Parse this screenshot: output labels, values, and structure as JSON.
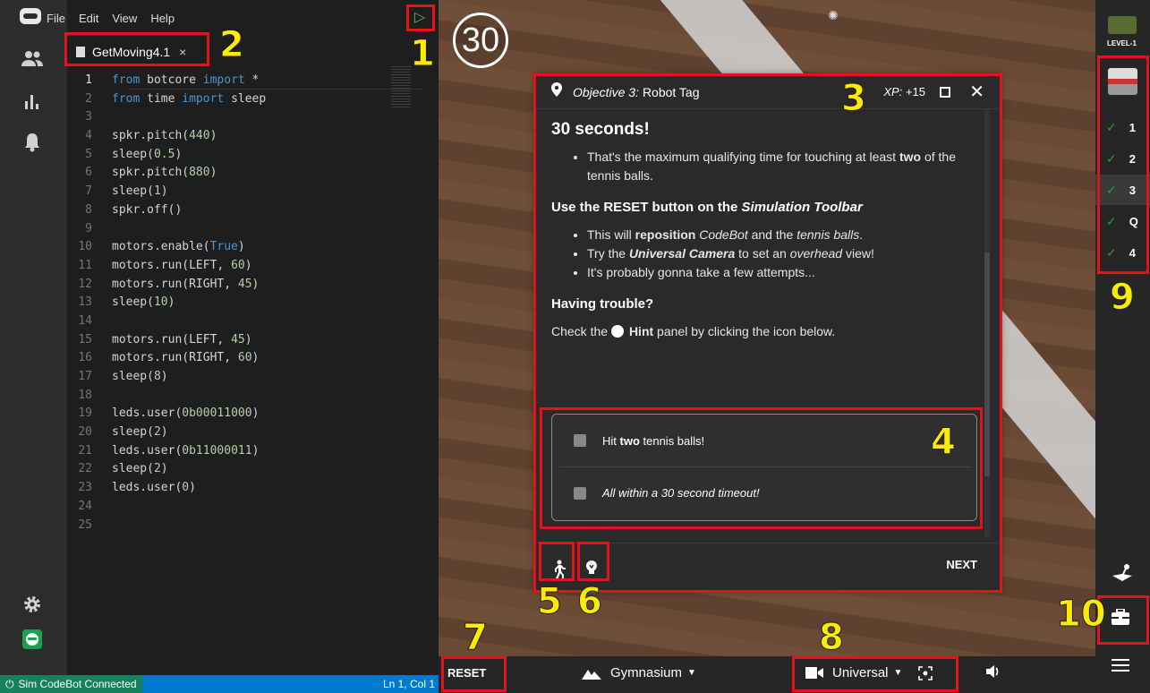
{
  "menu": {
    "file": "File",
    "edit": "Edit",
    "view": "View",
    "help": "Help"
  },
  "tab": {
    "filename": "GetMoving4.1",
    "close": "×"
  },
  "code": [
    {
      "n": "1",
      "t": "from botcore import *"
    },
    {
      "n": "2",
      "t": "from time import sleep"
    },
    {
      "n": "3",
      "t": ""
    },
    {
      "n": "4",
      "t": "spkr.pitch(440)"
    },
    {
      "n": "5",
      "t": "sleep(0.5)"
    },
    {
      "n": "6",
      "t": "spkr.pitch(880)"
    },
    {
      "n": "7",
      "t": "sleep(1)"
    },
    {
      "n": "8",
      "t": "spkr.off()"
    },
    {
      "n": "9",
      "t": ""
    },
    {
      "n": "10",
      "t": "motors.enable(True)"
    },
    {
      "n": "11",
      "t": "motors.run(LEFT, 60)"
    },
    {
      "n": "12",
      "t": "motors.run(RIGHT, 45)"
    },
    {
      "n": "13",
      "t": "sleep(10)"
    },
    {
      "n": "14",
      "t": ""
    },
    {
      "n": "15",
      "t": "motors.run(LEFT, 45)"
    },
    {
      "n": "16",
      "t": "motors.run(RIGHT, 60)"
    },
    {
      "n": "17",
      "t": "sleep(8)"
    },
    {
      "n": "18",
      "t": ""
    },
    {
      "n": "19",
      "t": "leds.user(0b00011000)"
    },
    {
      "n": "20",
      "t": "sleep(2)"
    },
    {
      "n": "21",
      "t": "leds.user(0b11000011)"
    },
    {
      "n": "22",
      "t": "sleep(2)"
    },
    {
      "n": "23",
      "t": "leds.user(0)"
    },
    {
      "n": "24",
      "t": ""
    },
    {
      "n": "25",
      "t": ""
    }
  ],
  "status": {
    "left": "Sim CodeBot Connected",
    "right": "Ln 1, Col 1"
  },
  "sim": {
    "timer": "30"
  },
  "objective": {
    "prefix": "Objective 3:",
    "title": "Robot Tag",
    "xp_label": "XP:",
    "xp_value": "+15",
    "heading": "30 seconds!",
    "bullet1_pre": "That's the maximum qualifying time for touching at least ",
    "bullet1_bold": "two",
    "bullet1_post": " of the tennis balls.",
    "reset_heading_pre": "Use the RESET button on the ",
    "reset_heading_em": "Simulation Toolbar",
    "b2_pre": "This will ",
    "b2_bold": "reposition",
    "b2_mid": " ",
    "b2_em1": "CodeBot",
    "b2_and": " and the ",
    "b2_em2": "tennis balls",
    "b2_end": ".",
    "b3_pre": "Try the ",
    "b3_bold": "Universal Camera",
    "b3_mid": " to set an ",
    "b3_em": "overhead",
    "b3_end": " view!",
    "b4": "It's probably gonna take a few attempts...",
    "trouble_heading": "Having trouble?",
    "check_pre": "Check the ",
    "check_bold": "Hint",
    "check_post": " panel by clicking the icon below.",
    "goal1_pre": "Hit ",
    "goal1_bold": "two",
    "goal1_post": " tennis balls!",
    "goal2": "All within a 30 second timeout!",
    "next": "NEXT"
  },
  "toolbar": {
    "reset": "RESET",
    "environment": "Gymnasium",
    "camera": "Universal"
  },
  "rail": {
    "level_label": "LEVEL-1",
    "steps": [
      "1",
      "2",
      "3",
      "Q",
      "4"
    ]
  },
  "annotations": [
    "1",
    "2",
    "3",
    "4",
    "5",
    "6",
    "7",
    "8",
    "9",
    "10"
  ],
  "colors": {
    "annotation": "#e4131b",
    "annotation_number": "#ffeb00",
    "status_bar": "#007acc",
    "play": "#3fbf5f"
  }
}
